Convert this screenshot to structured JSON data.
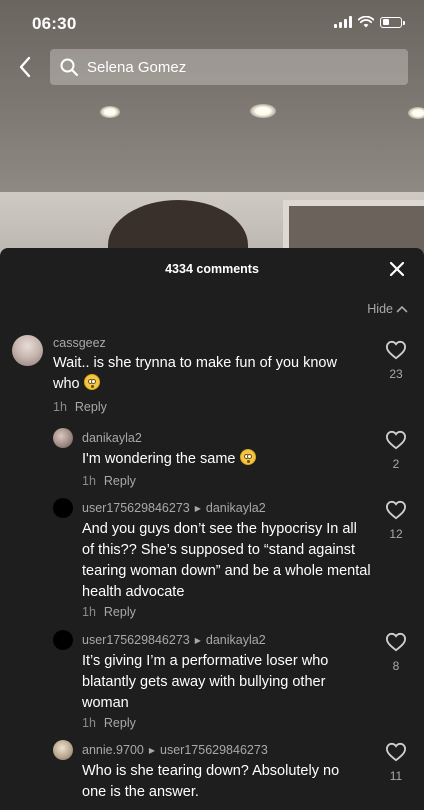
{
  "status_bar": {
    "time": "06:30"
  },
  "search": {
    "value": "Selena Gomez"
  },
  "comments_panel": {
    "title": "4334 comments",
    "hide_label": "Hide"
  },
  "comments": [
    {
      "username": "cassgeez",
      "text": "Wait.. is she trynna to make fun of you know who",
      "has_emoji": true,
      "time": "1h",
      "reply_label": "Reply",
      "likes": "23"
    },
    {
      "username": "danikayla2",
      "text": "I'm wondering the same",
      "has_emoji": true,
      "time": "1h",
      "reply_label": "Reply",
      "likes": "2"
    },
    {
      "username": "user175629846273",
      "reply_to": "danikayla2",
      "text": "And you guys don’t see the hypocrisy In all of this?? She’s supposed to “stand against tearing woman down” and be a whole mental health advocate",
      "time": "1h",
      "reply_label": "Reply",
      "likes": "12"
    },
    {
      "username": "user175629846273",
      "reply_to": "danikayla2",
      "text": "It’s giving I’m a performative loser who blatantly gets away with bullying other woman",
      "time": "1h",
      "reply_label": "Reply",
      "likes": "8"
    },
    {
      "username": "annie.9700",
      "reply_to": "user175629846273",
      "text": "Who is she tearing down? Absolutely no one is the answer.",
      "likes": "11"
    }
  ]
}
